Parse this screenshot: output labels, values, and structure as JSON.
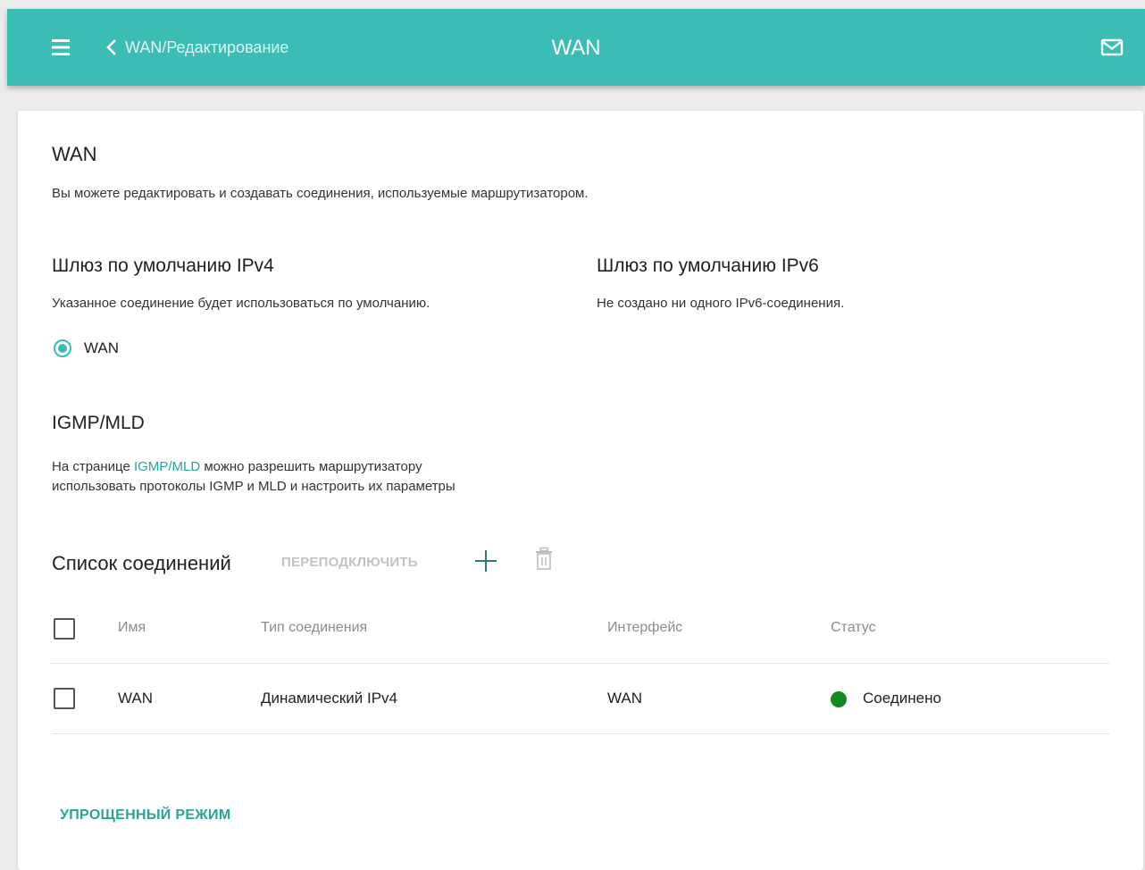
{
  "header": {
    "back_label": "WAN/Редактирование",
    "title": "WAN"
  },
  "main": {
    "title": "WAN",
    "description": "Вы можете редактировать и создавать соединения, используемые маршрутизатором."
  },
  "gateway_ipv4": {
    "title": "Шлюз по умолчанию IPv4",
    "description": "Указанное соединение будет использоваться по умолчанию.",
    "selected_option": "WAN"
  },
  "gateway_ipv6": {
    "title": "Шлюз по умолчанию IPv6",
    "description": "Не создано ни одного IPv6-соединения."
  },
  "igmp": {
    "title": "IGMP/MLD",
    "text_before": "На странице ",
    "link": "IGMP/MLD",
    "text_after": " можно разрешить маршрутизатору",
    "text_line2": "использовать протоколы IGMP и MLD и настроить их параметры"
  },
  "connections": {
    "title": "Список соединений",
    "reconnect_label": "ПЕРЕПОДКЛЮЧИТЬ",
    "columns": [
      "Имя",
      "Тип соединения",
      "Интерфейс",
      "Статус"
    ],
    "rows": [
      {
        "name": "WAN",
        "type": "Динамический IPv4",
        "interface": "WAN",
        "status": "Соединено"
      }
    ]
  },
  "footer": {
    "simple_mode_label": "УПРОЩЕННЫЙ РЕЖИМ"
  },
  "colors": {
    "accent": "#3bbcb4",
    "link": "#2aa39b",
    "status_connected": "#138a1f"
  },
  "icons": [
    "menu-icon",
    "chevron-left-icon",
    "mail-icon",
    "plus-icon",
    "trash-icon"
  ]
}
